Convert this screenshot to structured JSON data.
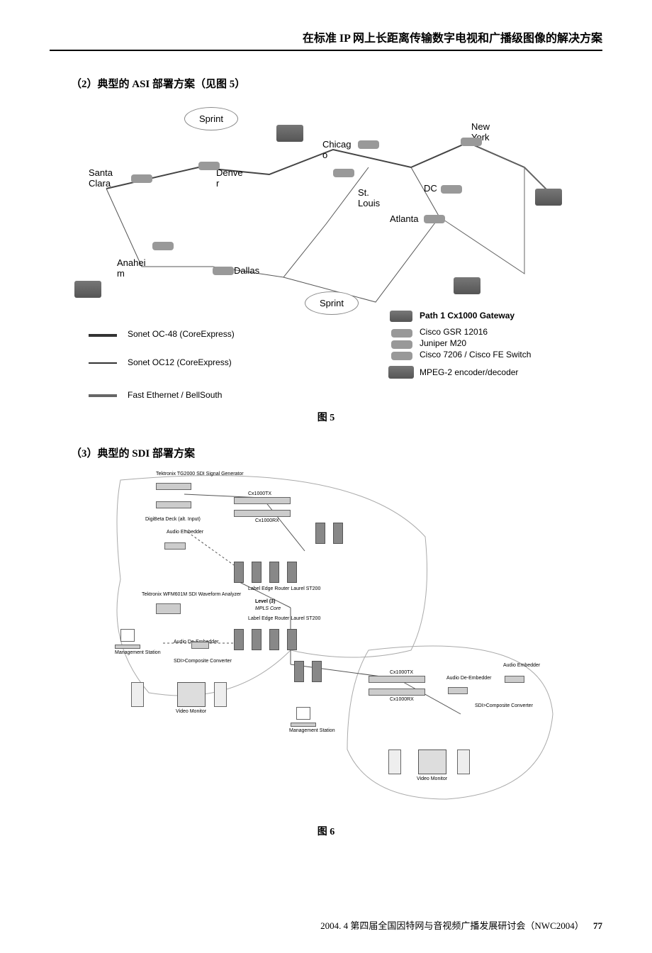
{
  "header_title": "在标准 IP 网上长距离传输数字电视和广播级图像的解决方案",
  "section_2": "（2）典型的 ASI 部署方案（见图 5）",
  "section_3": "（3）典型的 SDI 部署方案",
  "fig5_caption": "图 5",
  "fig6_caption": "图 6",
  "footer": "2004. 4   第四届全国因特网与音视频广播发展研讨会（NWC2004）",
  "page_num": "77",
  "fig5": {
    "sprint1": "Sprint",
    "sprint2": "Sprint",
    "santa_clara": "Santa\nClara",
    "denver": "Denve\nr",
    "chicago": "Chicag\no",
    "st_louis": "St.\nLouis",
    "new_york": "New\nYork",
    "dc": "DC",
    "atlanta": "Atlanta",
    "anaheim": "Anahei\nm",
    "dallas": "Dallas",
    "legend1": "Sonet OC-48 (CoreExpress)",
    "legend2": "Sonet OC12 (CoreExpress)",
    "legend3": "Fast  Ethernet  /  BellSouth",
    "legend4": "Path 1 Cx1000 Gateway",
    "legend5": "Cisco GSR 12016",
    "legend6": "Juniper M20",
    "legend7": "Cisco 7206 / Cisco FE Switch",
    "legend8": "MPEG-2 encoder/decoder"
  },
  "fig6": {
    "tg2000": "Tektronix TG2000\nSDI Signal Generator",
    "cx1000tx": "Cx1000TX",
    "cx1000rx": "Cx1000RX",
    "digibeta": "DigiBeta Deck (alt. Input)",
    "audio_emb": "Audio\nEmbedder",
    "audio_deemb": "Audio\nDe-Embedder",
    "wfm601": "Tektronix WFM601M\nSDI Waveform Analyzer",
    "mgmt": "Management\nStation",
    "ler": "Label Edge Router\nLaurel ST200",
    "level3": "Level (3)",
    "mpls": "MPLS Core",
    "sdi_comp": "SDI>Composite\nConverter",
    "video_mon": "Video Monitor"
  }
}
